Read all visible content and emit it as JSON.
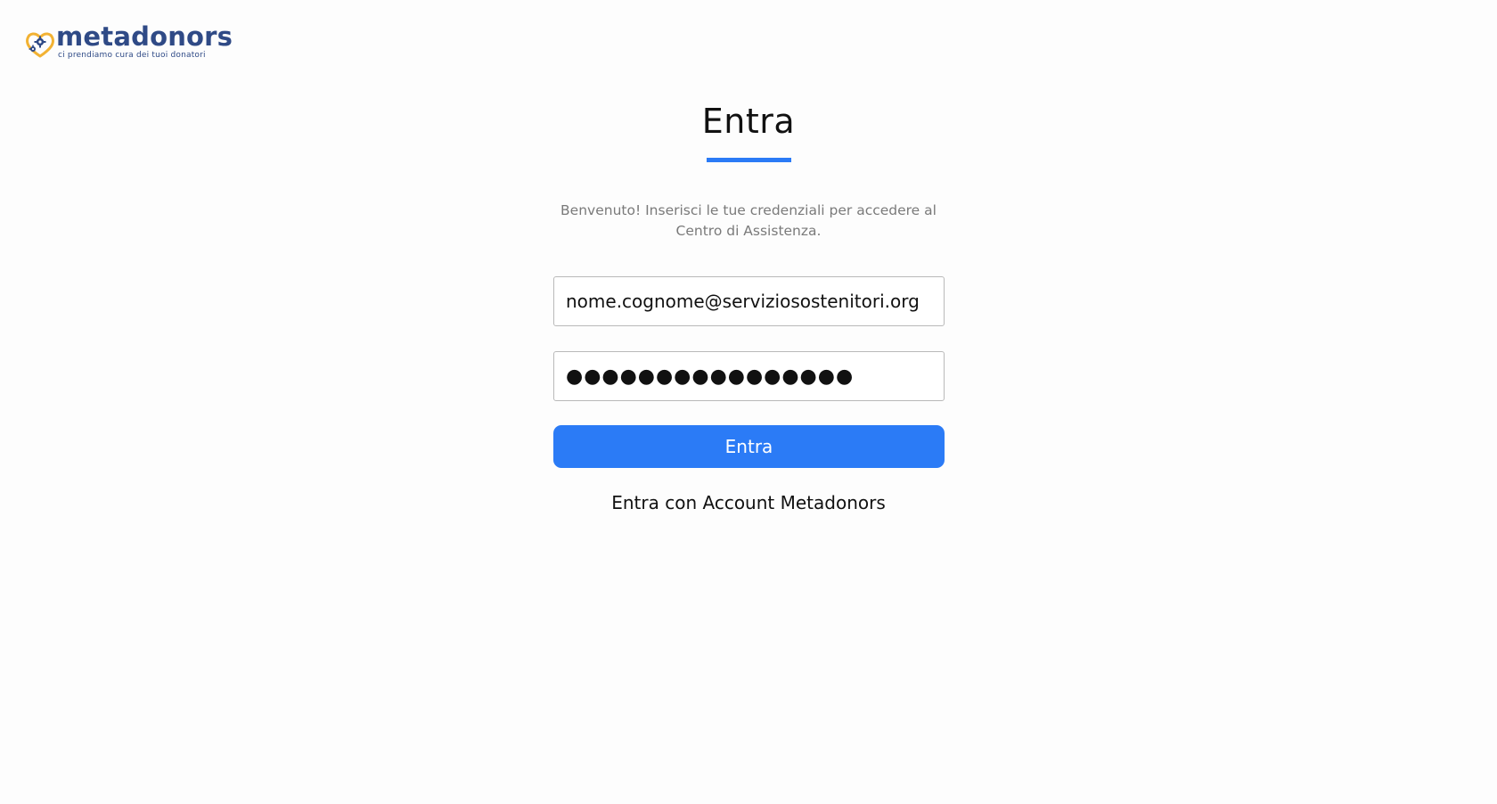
{
  "brand": {
    "name": "metadonors",
    "tagline": "ci prendiamo cura dei tuoi donatori",
    "icon": "heart-gears-logo-icon",
    "colors": {
      "primary": "#2f4a86",
      "accent": "#f2b233"
    }
  },
  "login": {
    "title": "Entra",
    "intro": "Benvenuto! Inserisci le tue credenziali per accedere al Centro di Assistenza.",
    "email_value": "nome.cognome@serviziosostenitori.org",
    "password_mask": "●●●●●●●●●●●●●●●●",
    "submit_label": "Entra",
    "alt_login_label": "Entra con Account Metadonors"
  },
  "colors": {
    "button": "#2b7bf6",
    "underline": "#2b7bf6",
    "intro_text": "#7a7a7a"
  }
}
